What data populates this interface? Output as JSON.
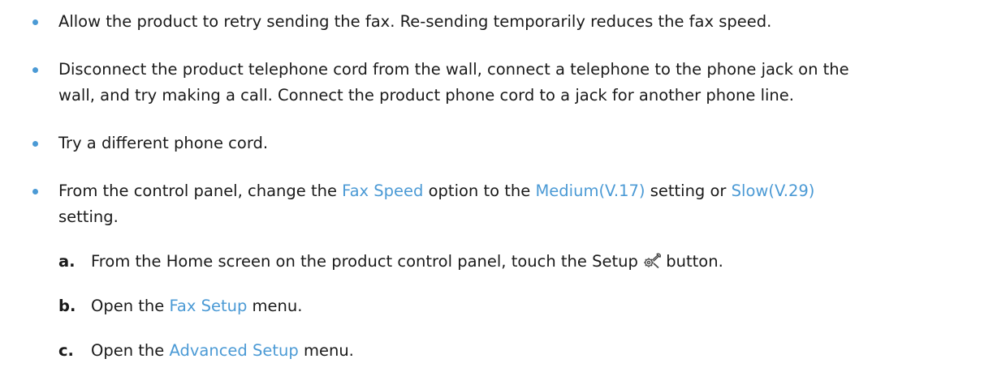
{
  "bullets": [
    {
      "lines": [
        "Allow the product to retry sending the fax. Re-sending temporarily reduces the fax speed."
      ]
    },
    {
      "lines": [
        "Disconnect the product telephone cord from the wall, connect a telephone to the phone jack on the",
        "wall, and try making a call. Connect the product phone cord to a jack for another phone line."
      ]
    },
    {
      "lines": [
        "Try a different phone cord."
      ]
    },
    {
      "l1_a": "From the control panel, change the ",
      "l1_hl1": "Fax Speed",
      "l1_b": " option to the ",
      "l1_hl2": "Medium(V.17)",
      "l1_c": " setting or ",
      "l1_hl3": "Slow(V.29)",
      "l2": "setting."
    }
  ],
  "steps": [
    {
      "letter": "a.",
      "text_a": "From the Home screen on the product control panel, touch the Setup ",
      "icon": "setup-wrench-gear-icon",
      "text_b": " button."
    },
    {
      "letter": "b.",
      "text_a": "Open the ",
      "hl": "Fax Setup",
      "text_b": " menu."
    },
    {
      "letter": "c.",
      "text_a": "Open the ",
      "hl": "Advanced Setup",
      "text_b": " menu."
    }
  ],
  "colors": {
    "accent": "#4b9ad5",
    "text": "#1a1a1a"
  }
}
